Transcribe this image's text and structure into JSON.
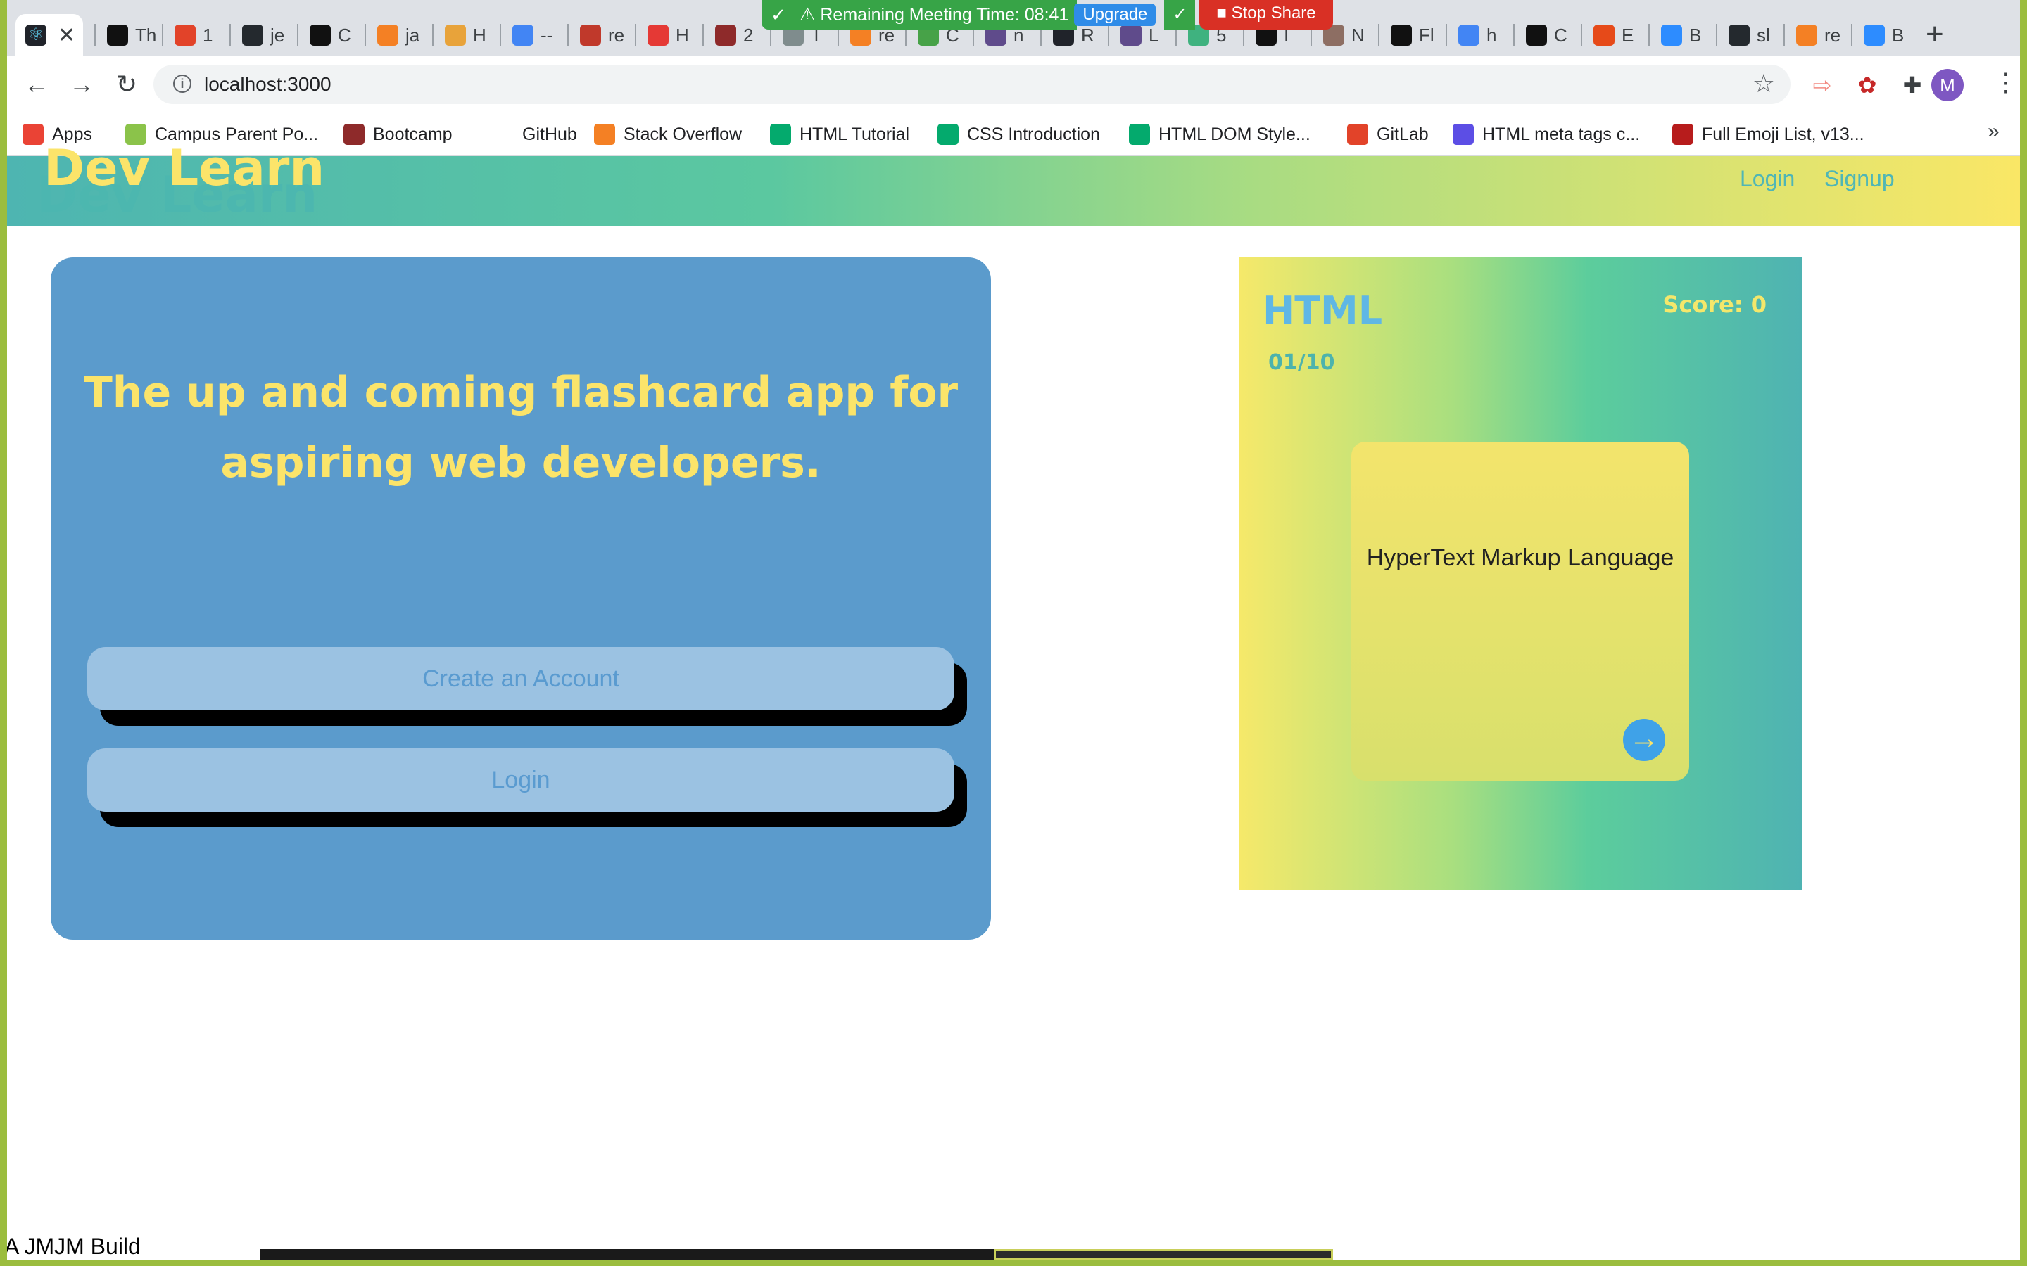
{
  "browser": {
    "tabs": [
      {
        "label": "",
        "color": "#20232a",
        "icon": "react-icon"
      },
      {
        "label": "Th",
        "color": "#111111",
        "icon": "medium-icon"
      },
      {
        "label": "1",
        "color": "#e24329",
        "icon": "gitlab-icon"
      },
      {
        "label": "je",
        "color": "#24292e",
        "icon": "github-icon"
      },
      {
        "label": "C",
        "color": "#111111",
        "icon": "medium-icon"
      },
      {
        "label": "ja",
        "color": "#f48024",
        "icon": "stackoverflow-icon"
      },
      {
        "label": "H",
        "color": "#e8a33a",
        "icon": "ninja-icon"
      },
      {
        "label": "--",
        "color": "#4285f4",
        "icon": "google-icon"
      },
      {
        "label": "re",
        "color": "#c0392b",
        "icon": "n-icon"
      },
      {
        "label": "H",
        "color": "#e53935",
        "icon": "c-icon"
      },
      {
        "label": "2",
        "color": "#8e2a2a",
        "icon": "bootcamp-icon"
      },
      {
        "label": "T",
        "color": "#7f8c8d",
        "icon": "terminal-icon"
      },
      {
        "label": "re",
        "color": "#f48024",
        "icon": "stackoverflow-icon"
      },
      {
        "label": "C",
        "color": "#47a248",
        "icon": "mongodb-icon"
      },
      {
        "label": "n",
        "color": "#5f4b8b",
        "icon": "heroku-icon"
      },
      {
        "label": "R",
        "color": "#20232a",
        "icon": "react-icon"
      },
      {
        "label": "L",
        "color": "#5f4b8b",
        "icon": "heroku-icon"
      },
      {
        "label": "5",
        "color": "#3fb27f",
        "icon": "vue-icon"
      },
      {
        "label": "I",
        "color": "#111111",
        "icon": "flatiron-icon"
      },
      {
        "label": "N",
        "color": "#8d6e63",
        "icon": "avatar-icon"
      },
      {
        "label": "Fl",
        "color": "#111111",
        "icon": "codepen-icon"
      },
      {
        "label": "h",
        "color": "#4285f4",
        "icon": "google-icon"
      },
      {
        "label": "C",
        "color": "#111111",
        "icon": "codepen-icon"
      },
      {
        "label": "E",
        "color": "#e64a19",
        "icon": "asterisk-icon"
      },
      {
        "label": "B",
        "color": "#2d8cff",
        "icon": "zoom-icon"
      },
      {
        "label": "sl",
        "color": "#24292e",
        "icon": "github-icon"
      },
      {
        "label": "re",
        "color": "#f48024",
        "icon": "stackoverflow-icon"
      },
      {
        "label": "B",
        "color": "#2d8cff",
        "icon": "zoom-icon"
      }
    ],
    "new_tab": "+",
    "meeting": {
      "text": "Remaining Meeting Time: 08:41",
      "upgrade": "Upgrade",
      "stop": "Stop Share"
    },
    "url": "localhost:3000",
    "profile_initial": "M",
    "bookmarks": [
      {
        "label": "Apps",
        "color": "#ea4335",
        "icon": "apps-grid-icon"
      },
      {
        "label": "Campus Parent Po...",
        "color": "#8bc34a",
        "icon": "campus-icon"
      },
      {
        "label": "Bootcamp",
        "color": "#8e2a2a",
        "icon": "bootcamp-icon"
      },
      {
        "label": "GitHub",
        "color": "#ffffff",
        "icon": "github-icon"
      },
      {
        "label": "Stack Overflow",
        "color": "#f48024",
        "icon": "stackoverflow-icon"
      },
      {
        "label": "HTML Tutorial",
        "color": "#04aa6d",
        "icon": "w3schools-icon"
      },
      {
        "label": "CSS Introduction",
        "color": "#04aa6d",
        "icon": "w3schools-icon"
      },
      {
        "label": "HTML DOM Style...",
        "color": "#04aa6d",
        "icon": "w3schools-icon"
      },
      {
        "label": "GitLab",
        "color": "#e24329",
        "icon": "gitlab-icon"
      },
      {
        "label": "HTML meta tags c...",
        "color": "#5c4ee5",
        "icon": "meta-tags-icon"
      },
      {
        "label": "Full Emoji List, v13...",
        "color": "#b71c1c",
        "icon": "unicode-icon"
      }
    ],
    "bookmarks_more": "»"
  },
  "app": {
    "logo": "Dev Learn",
    "nav": {
      "login": "Login",
      "signup": "Signup"
    },
    "hero": {
      "title": "The up and coming flashcard app for aspiring web developers.",
      "create_account": "Create an Account",
      "login": "Login"
    },
    "deck": {
      "title": "HTML",
      "score_label": "Score: 0",
      "counter": "01/10",
      "card_text": "HyperText Markup Language"
    },
    "footer": "A JMJM Build"
  },
  "colors": {
    "accent_yellow": "#fbe46a",
    "hero_blue": "#5b9bcc",
    "button_blue": "#9bc2e2",
    "teal": "#4fb6b6"
  }
}
